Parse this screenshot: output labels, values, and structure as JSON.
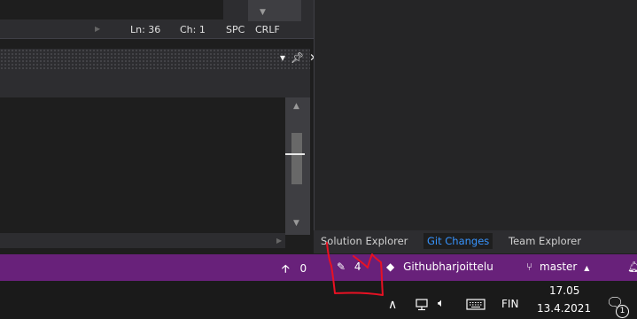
{
  "editor_status": {
    "line": "Ln: 36",
    "column": "Ch: 1",
    "indent": "SPC",
    "line_ending": "CRLF"
  },
  "panel_tabs": [
    {
      "label": "Solution Explorer",
      "active": false
    },
    {
      "label": "Git Changes",
      "active": true
    },
    {
      "label": "Team Explorer",
      "active": false
    }
  ],
  "status_bar": {
    "unpushed_count": "0",
    "pending_changes": "4",
    "repository": "Githubharjoittelu",
    "branch": "master",
    "bg_color": "#68217a"
  },
  "taskbar": {
    "language": "FIN",
    "time": "17.05",
    "date": "13.4.2021",
    "notification_count": "1"
  },
  "colors": {
    "accent": "#3794ff",
    "annotation": "#e81123"
  }
}
